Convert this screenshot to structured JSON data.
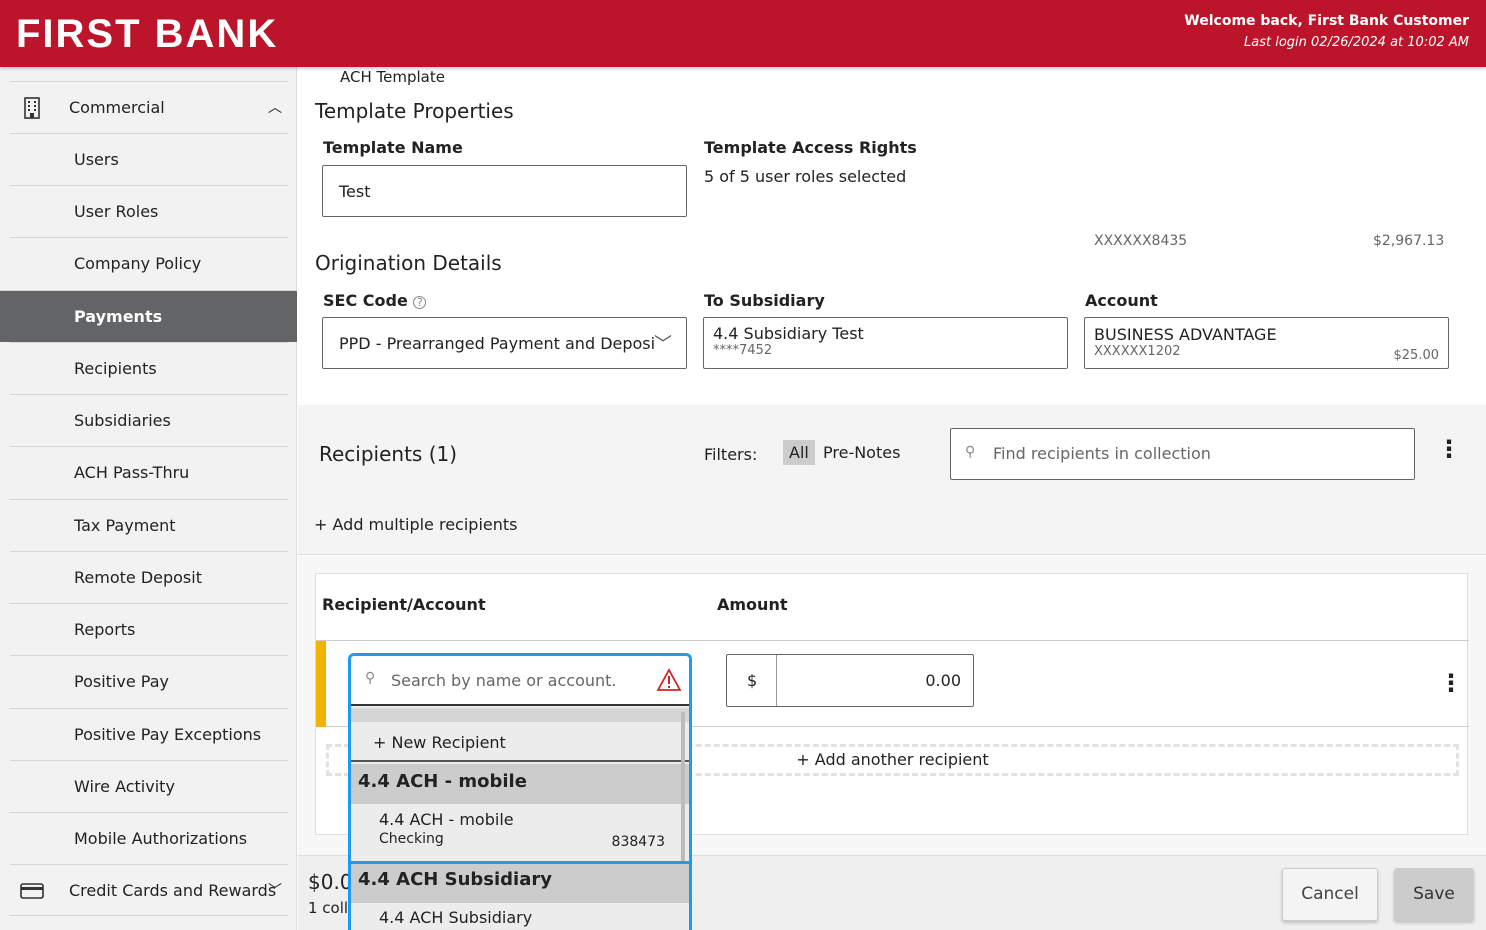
{
  "header": {
    "logo": "FIRST BANK",
    "welcome": "Welcome back, First Bank Customer",
    "last_login": "Last login 02/26/2024 at 10:02 AM"
  },
  "sidebar": {
    "group": "Commercial",
    "items": [
      {
        "label": "Users"
      },
      {
        "label": "User Roles"
      },
      {
        "label": "Company Policy"
      },
      {
        "label": "Payments"
      },
      {
        "label": "Recipients"
      },
      {
        "label": "Subsidiaries"
      },
      {
        "label": "ACH Pass-Thru"
      },
      {
        "label": "Tax Payment"
      },
      {
        "label": "Remote Deposit"
      },
      {
        "label": "Reports"
      },
      {
        "label": "Positive Pay"
      },
      {
        "label": "Positive Pay Exceptions"
      },
      {
        "label": "Wire Activity"
      },
      {
        "label": "Mobile Authorizations"
      }
    ],
    "group2": "Credit Cards and Rewards"
  },
  "breadcrumb": "ACH Template",
  "template": {
    "title": "Template Properties",
    "name_label": "Template Name",
    "name_value": "Test",
    "rights_label": "Template Access Rights",
    "rights_value": "5 of 5 user roles selected"
  },
  "floating_account": {
    "number": "XXXXXX8435",
    "balance": "$2,967.13"
  },
  "origination": {
    "title": "Origination Details",
    "sec_label": "SEC Code",
    "sec_value": "PPD - Prearranged Payment and Deposi",
    "sub_label": "To Subsidiary",
    "sub_name": "4.4 Subsidiary Test",
    "sub_acct": "****7452",
    "acct_label": "Account",
    "acct_name": "BUSINESS ADVANTAGE",
    "acct_number": "XXXXXX1202",
    "acct_balance": "$25.00"
  },
  "recipients": {
    "title": "Recipients (1)",
    "filters_label": "Filters:",
    "filter_all": "All",
    "filter_prenotes": "Pre-Notes",
    "search_placeholder": "Find recipients in collection",
    "add_multiple": "+ Add multiple recipients"
  },
  "table": {
    "col_recipient": "Recipient/Account",
    "col_amount": "Amount",
    "search_placeholder": "Search by name or account.",
    "currency": "$",
    "amount": "0.00",
    "add_another": "+ Add another recipient"
  },
  "dropdown": {
    "new_recipient": "+ New Recipient",
    "groups": [
      {
        "header": "4.4 ACH - mobile",
        "name": "4.4 ACH - mobile",
        "type": "Checking",
        "account": "838473"
      },
      {
        "header": "4.4 ACH Subsidiary",
        "name": "4.4 ACH Subsidiary"
      }
    ]
  },
  "footer": {
    "total": "$0.0",
    "count": "1 coll",
    "cancel": "Cancel",
    "save": "Save"
  },
  "colors": {
    "brand": "#bc152b",
    "focus": "#1a9cf0",
    "warning": "#f0b400"
  }
}
